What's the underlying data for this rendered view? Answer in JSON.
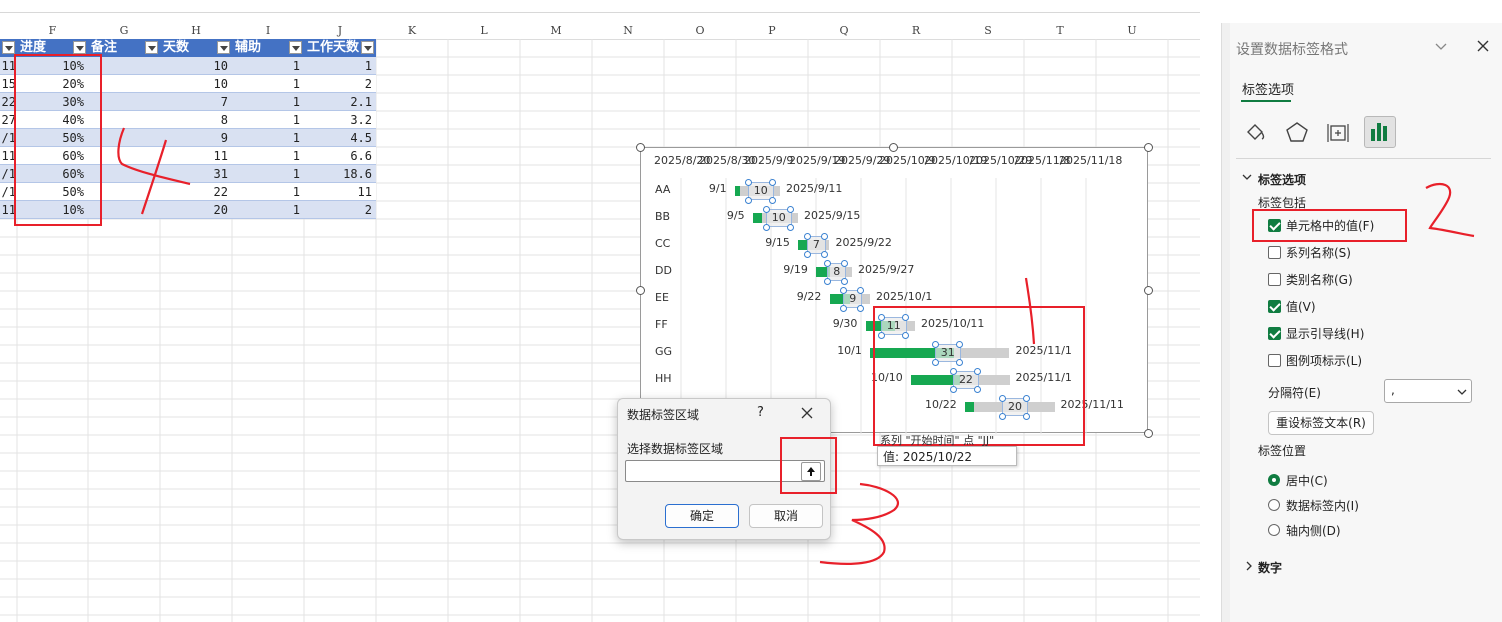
{
  "sheet": {
    "columns": [
      "F",
      "G",
      "H",
      "I",
      "J",
      "K",
      "L",
      "M",
      "N",
      "O",
      "P",
      "Q",
      "R",
      "S",
      "T",
      "U"
    ],
    "headers": [
      "进度",
      "备注",
      "天数",
      "辅助",
      "工作天数"
    ],
    "left_fragments": [
      "11",
      "15",
      "22",
      "27",
      "/1",
      "11",
      "/1",
      "/1",
      "11"
    ],
    "rows": [
      {
        "progress": "10%",
        "days": "10",
        "aux": "1",
        "work": "1"
      },
      {
        "progress": "20%",
        "days": "10",
        "aux": "1",
        "work": "2"
      },
      {
        "progress": "30%",
        "days": "7",
        "aux": "1",
        "work": "2.1"
      },
      {
        "progress": "40%",
        "days": "8",
        "aux": "1",
        "work": "3.2"
      },
      {
        "progress": "50%",
        "days": "9",
        "aux": "1",
        "work": "4.5"
      },
      {
        "progress": "60%",
        "days": "11",
        "aux": "1",
        "work": "6.6"
      },
      {
        "progress": "60%",
        "days": "31",
        "aux": "1",
        "work": "18.6"
      },
      {
        "progress": "50%",
        "days": "22",
        "aux": "1",
        "work": "11"
      },
      {
        "progress": "10%",
        "days": "20",
        "aux": "1",
        "work": "2"
      }
    ]
  },
  "chart": {
    "x_ticks": [
      "2025/8/20",
      "2025/8/30",
      "2025/9/9",
      "2025/9/19",
      "2025/9/29",
      "2025/10/9",
      "2025/10/19",
      "2025/10/29",
      "2025/11/8",
      "2025/11/18"
    ],
    "tasks": [
      {
        "name": "AA",
        "start": "9/1",
        "end": "2025/9/11",
        "days": "10"
      },
      {
        "name": "BB",
        "start": "9/5",
        "end": "2025/9/15",
        "days": "10"
      },
      {
        "name": "CC",
        "start": "9/15",
        "end": "2025/9/22",
        "days": "7"
      },
      {
        "name": "DD",
        "start": "9/19",
        "end": "2025/9/27",
        "days": "8"
      },
      {
        "name": "EE",
        "start": "9/22",
        "end": "2025/10/1",
        "days": "9"
      },
      {
        "name": "FF",
        "start": "9/30",
        "end": "2025/10/11",
        "days": "11"
      },
      {
        "name": "GG",
        "start": "10/1",
        "end": "2025/11/1",
        "days": "31"
      },
      {
        "name": "HH",
        "start": "10/10",
        "end": "2025/11/1",
        "days": "22"
      },
      {
        "name": "JJ",
        "start": "10/22",
        "end": "2025/11/11",
        "days": "20"
      }
    ],
    "colors": {
      "progress": "#16a851",
      "remaining": "#cfcfcf"
    },
    "tooltip_series": "系列 \"开始时间\" 点 \"JJ\"",
    "tooltip_value": "值: 2025/10/22"
  },
  "dialog": {
    "title": "数据标签区域",
    "help": "?",
    "close_icon": "close-icon",
    "label": "选择数据标签区域",
    "input_value": "",
    "ok": "确定",
    "cancel": "取消"
  },
  "pane": {
    "title": "设置数据标签格式",
    "tab": "标签选项",
    "section": "标签选项",
    "include_label": "标签包括",
    "options": [
      {
        "label": "单元格中的值(F)",
        "checked": true
      },
      {
        "label": "系列名称(S)",
        "checked": false
      },
      {
        "label": "类别名称(G)",
        "checked": false
      },
      {
        "label": "值(V)",
        "checked": true
      },
      {
        "label": "显示引导线(H)",
        "checked": true
      },
      {
        "label": "图例项标示(L)",
        "checked": false
      }
    ],
    "separator_label": "分隔符(E)",
    "separator_value": ",",
    "reset_button": "重设标签文本(R)",
    "position_label": "标签位置",
    "positions": [
      {
        "label": "居中(C)",
        "selected": true
      },
      {
        "label": "数据标签内(I)",
        "selected": false
      },
      {
        "label": "轴内侧(D)",
        "selected": false
      }
    ],
    "number_section": "数字"
  },
  "annotations": [
    "4",
    "3",
    "2",
    "1"
  ]
}
